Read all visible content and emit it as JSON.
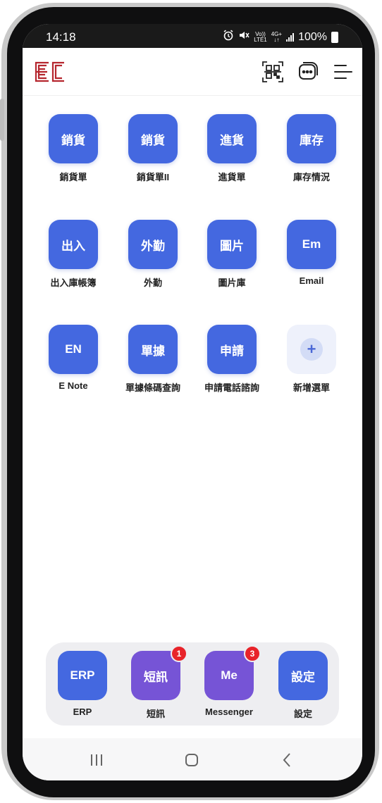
{
  "status_bar": {
    "time": "14:18",
    "volte_top": "Vo))",
    "volte_bottom": "LTE1",
    "network_top": "4G+",
    "network_bottom": "↓↑",
    "battery": "100%"
  },
  "header": {
    "logo_text": "EC",
    "icons": [
      "qr-code-icon",
      "chat-icon",
      "menu-icon"
    ]
  },
  "grid": [
    {
      "icon_text": "銷貨",
      "label": "銷貨單"
    },
    {
      "icon_text": "銷貨",
      "label": "銷貨單II"
    },
    {
      "icon_text": "進貨",
      "label": "進貨單"
    },
    {
      "icon_text": "庫存",
      "label": "庫存情況"
    },
    {
      "icon_text": "出入",
      "label": "出入庫帳簿"
    },
    {
      "icon_text": "外勤",
      "label": "外勤"
    },
    {
      "icon_text": "圖片",
      "label": "圖片庫"
    },
    {
      "icon_text": "Em",
      "label": "Email"
    },
    {
      "icon_text": "EN",
      "label": "E Note"
    },
    {
      "icon_text": "單據",
      "label": "單據條碼查詢"
    },
    {
      "icon_text": "申請",
      "label": "申請電話諮詢"
    },
    {
      "icon_text": "+",
      "label": "新增選單"
    }
  ],
  "dock": [
    {
      "icon_text": "ERP",
      "label": "ERP",
      "badge": ""
    },
    {
      "icon_text": "短訊",
      "label": "短訊",
      "badge": "1"
    },
    {
      "icon_text": "Me",
      "label": "Messenger",
      "badge": "3"
    },
    {
      "icon_text": "設定",
      "label": "設定",
      "badge": ""
    }
  ],
  "colors": {
    "tile_blue": "#4468e0",
    "tile_purple": "#7654d6",
    "badge_red": "#e8232a",
    "logo_red": "#b5262e"
  }
}
